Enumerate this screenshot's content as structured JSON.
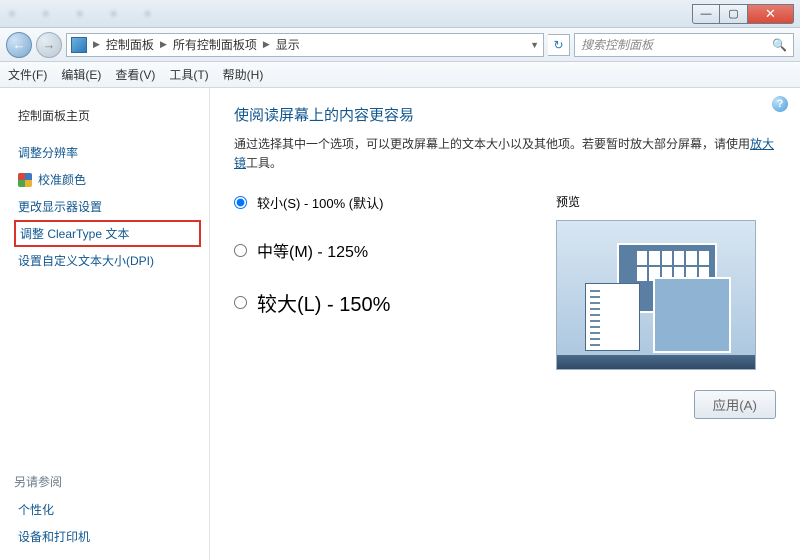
{
  "window": {
    "min": "—",
    "max": "▢",
    "close": "✕"
  },
  "nav": {
    "back": "←",
    "fwd": "→"
  },
  "breadcrumb": {
    "root": "控制面板",
    "mid": "所有控制面板项",
    "leaf": "显示"
  },
  "refresh_glyph": "↻",
  "search": {
    "placeholder": "搜索控制面板",
    "mag": "🔍"
  },
  "menu": {
    "file": "文件(F)",
    "edit": "编辑(E)",
    "view": "查看(V)",
    "tools": "工具(T)",
    "help": "帮助(H)"
  },
  "sidebar": {
    "home": "控制面板主页",
    "items": [
      "调整分辨率",
      "校准颜色",
      "更改显示器设置",
      "调整 ClearType 文本",
      "设置自定义文本大小(DPI)"
    ],
    "see_also_title": "另请参阅",
    "see_also": [
      "个性化",
      "设备和打印机"
    ]
  },
  "main": {
    "title": "使阅读屏幕上的内容更容易",
    "desc_pre": "通过选择其中一个选项，可以更改屏幕上的文本大小以及其他项。若要暂时放大部分屏幕，请使用",
    "desc_link": "放大镜",
    "desc_post": "工具。",
    "options": [
      {
        "label": "较小(S) - 100% (默认)",
        "checked": true
      },
      {
        "label": "中等(M) - 125%",
        "checked": false
      },
      {
        "label": "较大(L) - 150%",
        "checked": false
      }
    ],
    "preview_title": "预览",
    "apply": "应用(A)"
  },
  "help_glyph": "?"
}
